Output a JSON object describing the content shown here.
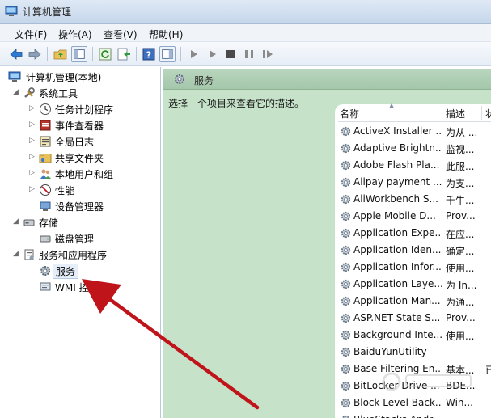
{
  "window": {
    "title": "计算机管理"
  },
  "menu": [
    "文件(F)",
    "操作(A)",
    "查看(V)",
    "帮助(H)"
  ],
  "toolbar_icons": [
    "back-arrow-icon",
    "forward-arrow-icon",
    "up-folder-icon",
    "show-hide-tree-icon",
    "refresh-icon",
    "export-list-icon",
    "help-icon",
    "show-hide-action-pane-icon",
    "play-icon",
    "play-alt-icon",
    "stop-icon",
    "pause-icon",
    "restart-icon"
  ],
  "tree": {
    "root": "计算机管理(本地)",
    "system_tools": "系统工具",
    "task_scheduler": "任务计划程序",
    "event_viewer": "事件查看器",
    "shared_folders": "共享文件夹",
    "local_users": "本地用户和组",
    "performance": "性能",
    "device_manager": "设备管理器",
    "storage": "存储",
    "disk_management": "磁盘管理",
    "services_apps": "服务和应用程序",
    "services": "服务",
    "wmi": "WMI 控件",
    "full_log": "全局日志"
  },
  "right": {
    "header_title": "服务",
    "description_hint": "选择一个项目来查看它的描述。",
    "columns": {
      "name": "名称",
      "desc": "描述",
      "status": "状"
    }
  },
  "services": [
    {
      "name": "ActiveX Installer ...",
      "desc": "为从 ...",
      "extra": ""
    },
    {
      "name": "Adaptive Brightn...",
      "desc": "监视...",
      "extra": ""
    },
    {
      "name": "Adobe Flash Pla...",
      "desc": "此服...",
      "extra": ""
    },
    {
      "name": "Alipay payment ...",
      "desc": "为支...",
      "extra": ""
    },
    {
      "name": "AliWorkbench S...",
      "desc": "千牛...",
      "extra": ""
    },
    {
      "name": "Apple Mobile D...",
      "desc": "Prov...",
      "extra": ""
    },
    {
      "name": "Application Expe...",
      "desc": "在应...",
      "extra": ""
    },
    {
      "name": "Application Iden...",
      "desc": "确定...",
      "extra": ""
    },
    {
      "name": "Application Infor...",
      "desc": "使用...",
      "extra": ""
    },
    {
      "name": "Application Laye...",
      "desc": "为 In...",
      "extra": ""
    },
    {
      "name": "Application Man...",
      "desc": "为通...",
      "extra": ""
    },
    {
      "name": "ASP.NET State S...",
      "desc": "Prov...",
      "extra": ""
    },
    {
      "name": "Background Inte...",
      "desc": "使用...",
      "extra": ""
    },
    {
      "name": "BaiduYunUtility",
      "desc": "",
      "extra": ""
    },
    {
      "name": "Base Filtering En...",
      "desc": "基本...",
      "extra": "已"
    },
    {
      "name": "BitLocker Drive ...",
      "desc": "BDE...",
      "extra": ""
    },
    {
      "name": "Block Level Back...",
      "desc": "Win...",
      "extra": ""
    },
    {
      "name": "BlueStacks Andr...",
      "desc": "",
      "extra": ""
    }
  ],
  "colors": {
    "green_panel": "#c6e3c9",
    "green_header": "#a4c7aa",
    "annotation_arrow": "#c0141b"
  }
}
